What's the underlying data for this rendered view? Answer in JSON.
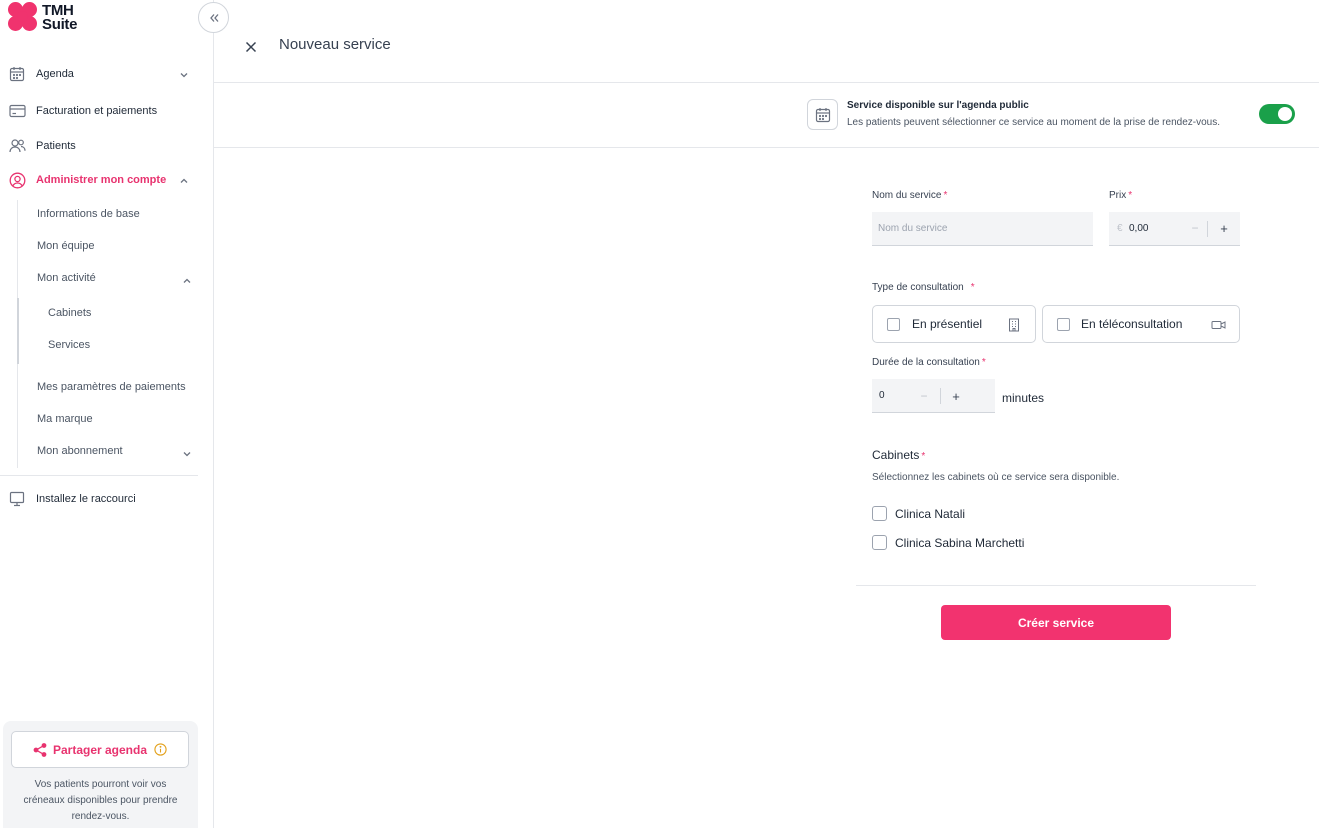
{
  "brand": {
    "line1": "TMH",
    "line2": "Suite",
    "accent": "#f0336e"
  },
  "sidebar": {
    "items": [
      {
        "label": "Agenda",
        "icon": "calendar-icon"
      },
      {
        "label": "Facturation et paiements",
        "icon": "credit-card-icon"
      },
      {
        "label": "Patients",
        "icon": "users-icon"
      },
      {
        "label": "Administrer mon compte",
        "icon": "user-circle-icon",
        "active": true
      },
      {
        "label": "Installez le raccourci",
        "icon": "monitor-icon"
      }
    ],
    "sub_items": [
      {
        "label": "Informations de base"
      },
      {
        "label": "Mon équipe"
      },
      {
        "label": "Mon activité"
      },
      {
        "label": "Mes paramètres de paiements"
      },
      {
        "label": "Ma marque"
      },
      {
        "label": "Mon abonnement"
      }
    ],
    "activity_items": [
      {
        "label": "Cabinets"
      },
      {
        "label": "Services"
      }
    ],
    "share": {
      "button_label": "Partager agenda",
      "description": "Vos patients pourront voir vos créneaux disponibles pour prendre rendez-vous."
    }
  },
  "page": {
    "title": "Nouveau service"
  },
  "public_agenda": {
    "title": "Service disponible sur l'agenda public",
    "description": "Les patients peuvent sélectionner ce service au moment de la prise de rendez-vous.",
    "enabled": true,
    "toggle_color": "#1aa04a"
  },
  "form": {
    "name": {
      "label": "Nom du service",
      "required_mark": "*",
      "placeholder": "Nom du service",
      "value": ""
    },
    "price": {
      "label": "Prix",
      "required_mark": "*",
      "currency": "€",
      "value": "0,00",
      "minus": "−",
      "plus": "+"
    },
    "consultation_type": {
      "label": "Type de consultation",
      "required_mark": "*",
      "options": [
        {
          "label": "En présentiel",
          "icon": "building-icon",
          "checked": false
        },
        {
          "label": "En téléconsultation",
          "icon": "video-icon",
          "checked": false
        }
      ]
    },
    "duration": {
      "label": "Durée de la consultation",
      "required_mark": "*",
      "value": "0",
      "minus": "−",
      "plus": "+",
      "unit": "minutes"
    },
    "cabinets": {
      "label": "Cabinets",
      "required_mark": "*",
      "description": "Sélectionnez les cabinets où ce service sera disponible.",
      "options": [
        {
          "label": "Clinica Natali",
          "checked": false
        },
        {
          "label": "Clinica Sabina Marchetti",
          "checked": false
        }
      ]
    },
    "submit_label": "Créer service",
    "submit_color": "#f2336f"
  }
}
